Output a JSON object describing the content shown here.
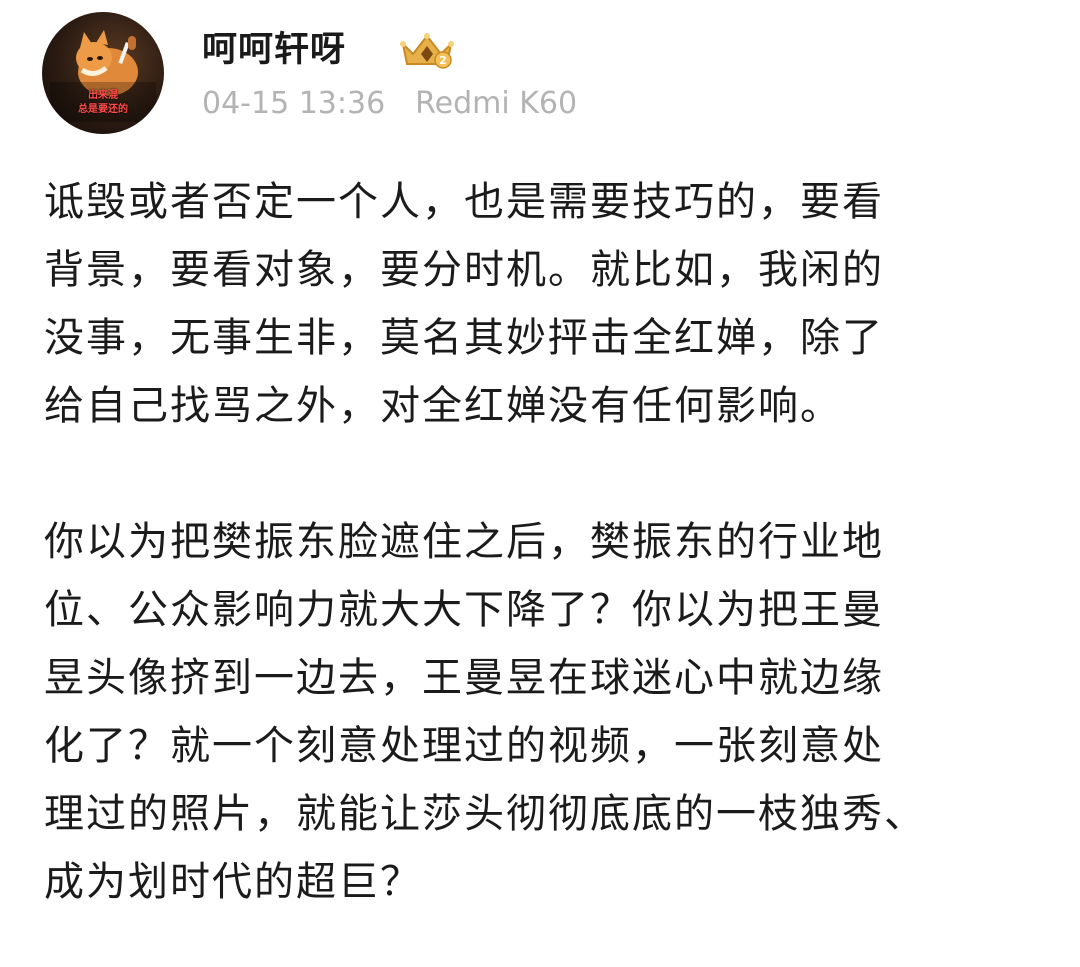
{
  "user": {
    "name": "呵呵轩呀",
    "badge_icon": "crown-level-2-badge",
    "badge_level": "2",
    "avatar_caption_line1": "出来混",
    "avatar_caption_line2": "总是要还的",
    "post_time": "04-15 13:36",
    "device": "Redmi K60"
  },
  "post": {
    "paragraphs": [
      "诋毁或者否定一个人，也是需要技巧的，要看\n背景，要看对象，要分时机。就比如，我闲的\n没事，无事生非，莫名其妙抨击全红婵，除了\n给自己找骂之外，对全红婵没有任何影响。",
      "你以为把樊振东脸遮住之后，樊振东的行业地\n位、公众影响力就大大下降了？你以为把王曼\n昱头像挤到一边去，王曼昱在球迷心中就边缘\n化了？就一个刻意处理过的视频，一张刻意处\n理过的照片，就能让莎头彻彻底底的一枝独秀、\n成为划时代的超巨？"
    ]
  },
  "colors": {
    "name": "#1a1a1a",
    "meta": "#b3b3b3",
    "body_text": "#1b1b1b",
    "badge_gold": "#e8b04a"
  }
}
